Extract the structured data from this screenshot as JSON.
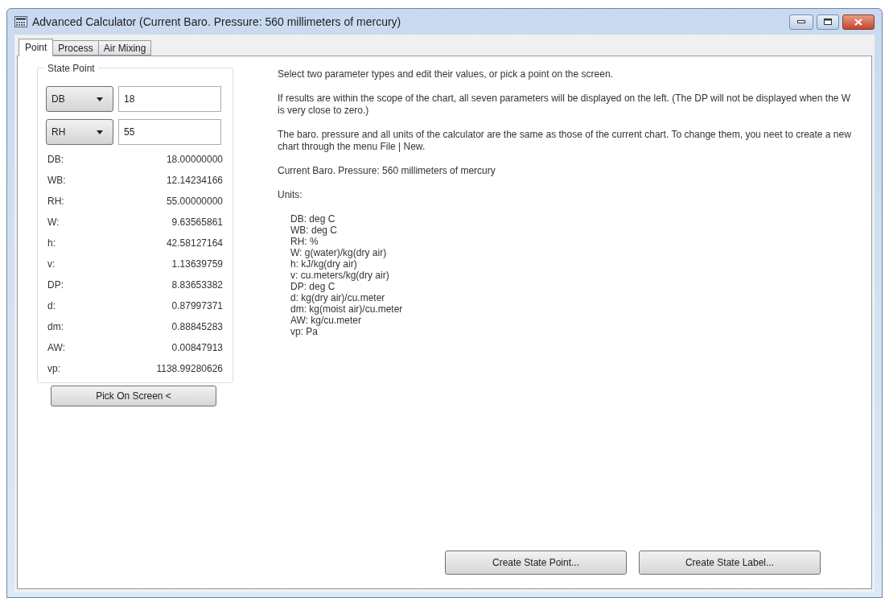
{
  "window": {
    "title": "Advanced Calculator (Current Baro. Pressure: 560 millimeters of mercury)"
  },
  "tabs": [
    {
      "label": "Point",
      "selected": true
    },
    {
      "label": "Process",
      "selected": false
    },
    {
      "label": "Air Mixing",
      "selected": false
    }
  ],
  "state_point": {
    "title": "State Point",
    "inputs": [
      {
        "parameter": "DB",
        "value": "18"
      },
      {
        "parameter": "RH",
        "value": "55"
      }
    ],
    "results": [
      {
        "name": "DB:",
        "value": "18.00000000"
      },
      {
        "name": "WB:",
        "value": "12.14234166"
      },
      {
        "name": "RH:",
        "value": "55.00000000"
      },
      {
        "name": "W:",
        "value": "9.63565861"
      },
      {
        "name": "h:",
        "value": "42.58127164"
      },
      {
        "name": "v:",
        "value": "1.13639759"
      },
      {
        "name": "DP:",
        "value": "8.83653382"
      },
      {
        "name": "d:",
        "value": "0.87997371"
      },
      {
        "name": "dm:",
        "value": "0.88845283"
      },
      {
        "name": "AW:",
        "value": "0.00847913"
      },
      {
        "name": "vp:",
        "value": "1138.99280626"
      }
    ],
    "pick_button": "Pick On Screen <"
  },
  "instructions": [
    "Select two parameter types and edit their values, or pick a point on the screen.",
    "If results are within the scope of the chart, all seven parameters will be displayed on the left. (The DP will not be displayed when the W is very close to zero.)",
    "The baro. pressure and all units of the calculator are the same as those of the current chart. To change them, you neet to create a new chart through the menu File | New.",
    "Current Baro. Pressure: 560 millimeters of mercury",
    "Units:"
  ],
  "units": [
    "DB: deg C",
    "WB: deg C",
    "RH: %",
    "W: g(water)/kg(dry air)",
    "h: kJ/kg(dry air)",
    "v: cu.meters/kg(dry air)",
    "DP: deg C",
    "d: kg(dry air)/cu.meter",
    "dm: kg(moist air)/cu.meter",
    "AW: kg/cu.meter",
    "vp: Pa"
  ],
  "buttons": [
    "Create State Point...",
    "Create State Label..."
  ]
}
